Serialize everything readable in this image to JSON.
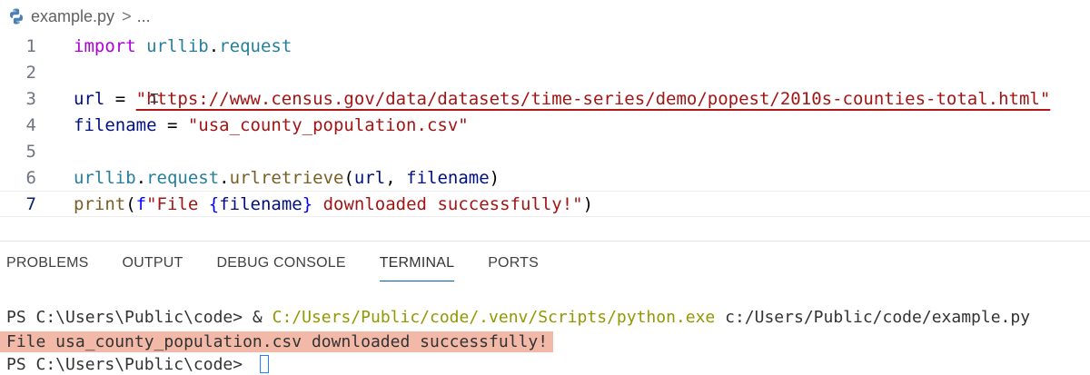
{
  "breadcrumb": {
    "file": "example.py",
    "separator": ">",
    "ellipsis": "..."
  },
  "editor": {
    "lines": [
      {
        "num": "1",
        "tokens": [
          "import",
          " ",
          "urllib",
          ".",
          "request"
        ]
      },
      {
        "num": "2"
      },
      {
        "num": "3",
        "tokens": [
          "url",
          " = ",
          "\"https://www.census.gov/data/datasets/time-series/demo/popest/2010s-counties-total.html\""
        ]
      },
      {
        "num": "4",
        "tokens": [
          "filename",
          " = ",
          "\"usa_county_population.csv\""
        ]
      },
      {
        "num": "5"
      },
      {
        "num": "6",
        "tokens": [
          "urllib",
          ".",
          "request",
          ".",
          "urlretrieve",
          "(",
          "url",
          ", ",
          "filename",
          ")"
        ]
      },
      {
        "num": "7",
        "tokens": [
          "print",
          "(",
          "f",
          "\"File ",
          "{",
          "filename",
          "}",
          " downloaded successfully!\"",
          ")"
        ]
      }
    ],
    "current_line": "7"
  },
  "panel": {
    "tabs": [
      "PROBLEMS",
      "OUTPUT",
      "DEBUG CONSOLE",
      "TERMINAL",
      "PORTS"
    ],
    "active_tab": "TERMINAL"
  },
  "terminal": {
    "line1_prompt": "PS C:\\Users\\Public\\code> & ",
    "line1_exe": "C:/Users/Public/code/.venv/Scripts/python.exe",
    "line1_arg": " c:/Users/Public/code/example.py",
    "line2_output": "File usa_county_population.csv downloaded successfully!",
    "line3_prompt": "PS C:\\Users\\Public\\code> "
  },
  "colors": {
    "keyword": "#af00db",
    "namespace": "#267f99",
    "variable": "#001080",
    "function": "#795e26",
    "string": "#a31515",
    "brace": "#0000ff",
    "terminal_path": "#949800",
    "output_highlight": "#f2b8a8",
    "active_tab_underline": "#005fb8"
  }
}
